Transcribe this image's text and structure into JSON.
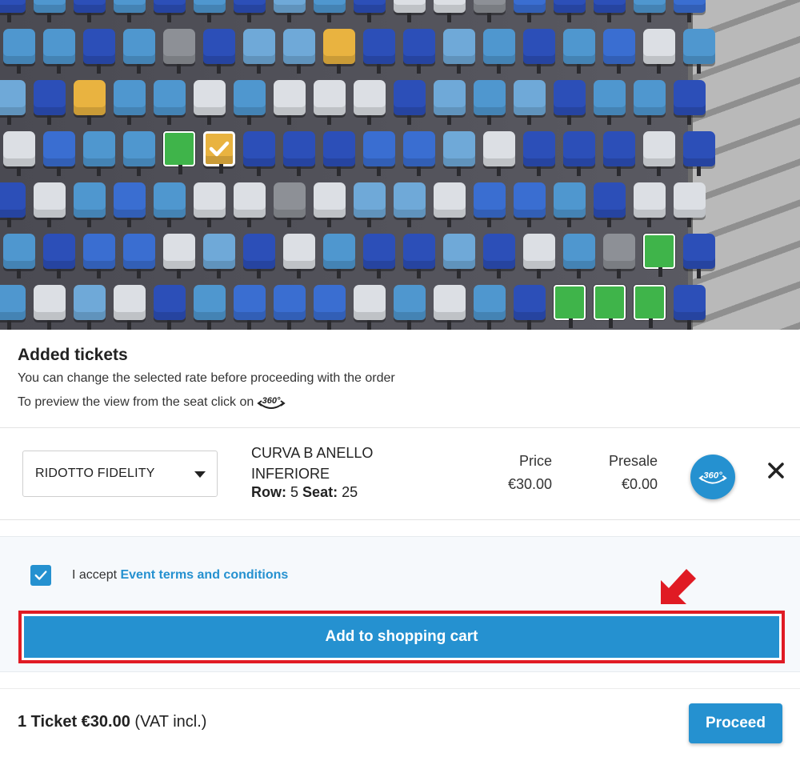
{
  "tickets": {
    "title": "Added tickets",
    "subtitle_rate": "You can change the selected rate before proceeding with the order",
    "subtitle_preview": "To preview the view from the seat click on",
    "icon_360": "360-view-icon"
  },
  "ticket": {
    "rate": "RIDOTTO FIDELITY",
    "sector": "CURVA B ANELLO INFERIORE",
    "row_label": "Row:",
    "row_value": "5",
    "seat_label": "Seat:",
    "seat_value": "25",
    "price_label": "Price",
    "price_value": "€30.00",
    "presale_label": "Presale",
    "presale_value": "€0.00"
  },
  "terms": {
    "prefix": "I accept",
    "link": "Event terms and conditions",
    "checked": true
  },
  "actions": {
    "add_to_cart": "Add to shopping cart",
    "proceed": "Proceed"
  },
  "footer": {
    "count_price": "1 Ticket €30.00",
    "vat": "(VAT incl.)"
  },
  "colors": {
    "accent": "#2591d0",
    "highlight": "#e01b24",
    "seat_available_green": "#3fb44a",
    "seat_selected": "#e9b340",
    "seat_dark_blue": "#2c4fb8",
    "seat_light_blue": "#4f97cf",
    "seat_white": "#dcdfe4",
    "seat_gray": "#8d9096"
  }
}
